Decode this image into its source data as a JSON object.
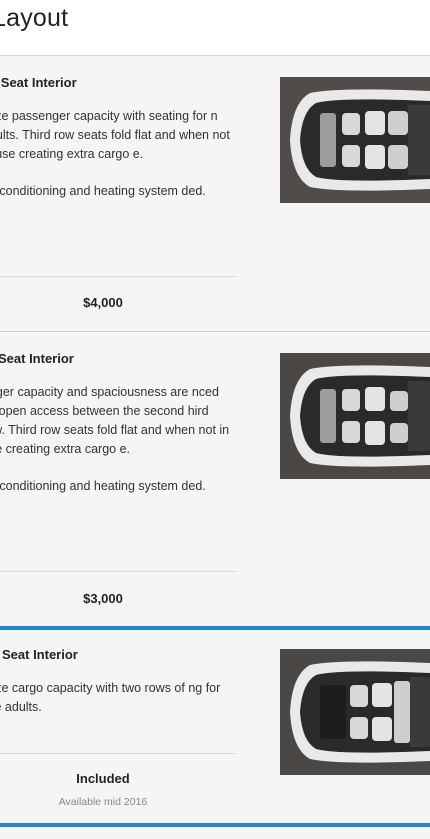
{
  "page": {
    "title": "Layout"
  },
  "options": [
    {
      "title": "en Seat Interior",
      "description": [
        "mize passenger capacity with seating for n adults. Third row seats fold flat and when not in use creating extra cargo e.",
        "air conditioning and heating system ded."
      ],
      "price": "$4,000",
      "note": "",
      "selected": false,
      "image_icon": "car-interior-top-view-icon"
    },
    {
      "title": "Seat Interior",
      "description": [
        "enger capacity and spaciousness are nced by open access between the second hird row. Third row seats fold flat and when not in use creating extra cargo e.",
        "air conditioning and heating system ded."
      ],
      "price": "$3,000",
      "note": "",
      "selected": false,
      "image_icon": "car-interior-top-view-icon"
    },
    {
      "title": "Seat Interior",
      "description": [
        "mize cargo capacity with two rows of ng for five adults."
      ],
      "price": "Included",
      "note": "Available mid 2016",
      "selected": true,
      "image_icon": "car-interior-top-view-icon"
    }
  ],
  "colors": {
    "accent": "#1e88d2",
    "background": "#f5f5f5",
    "image_bg": "#4b4744"
  }
}
